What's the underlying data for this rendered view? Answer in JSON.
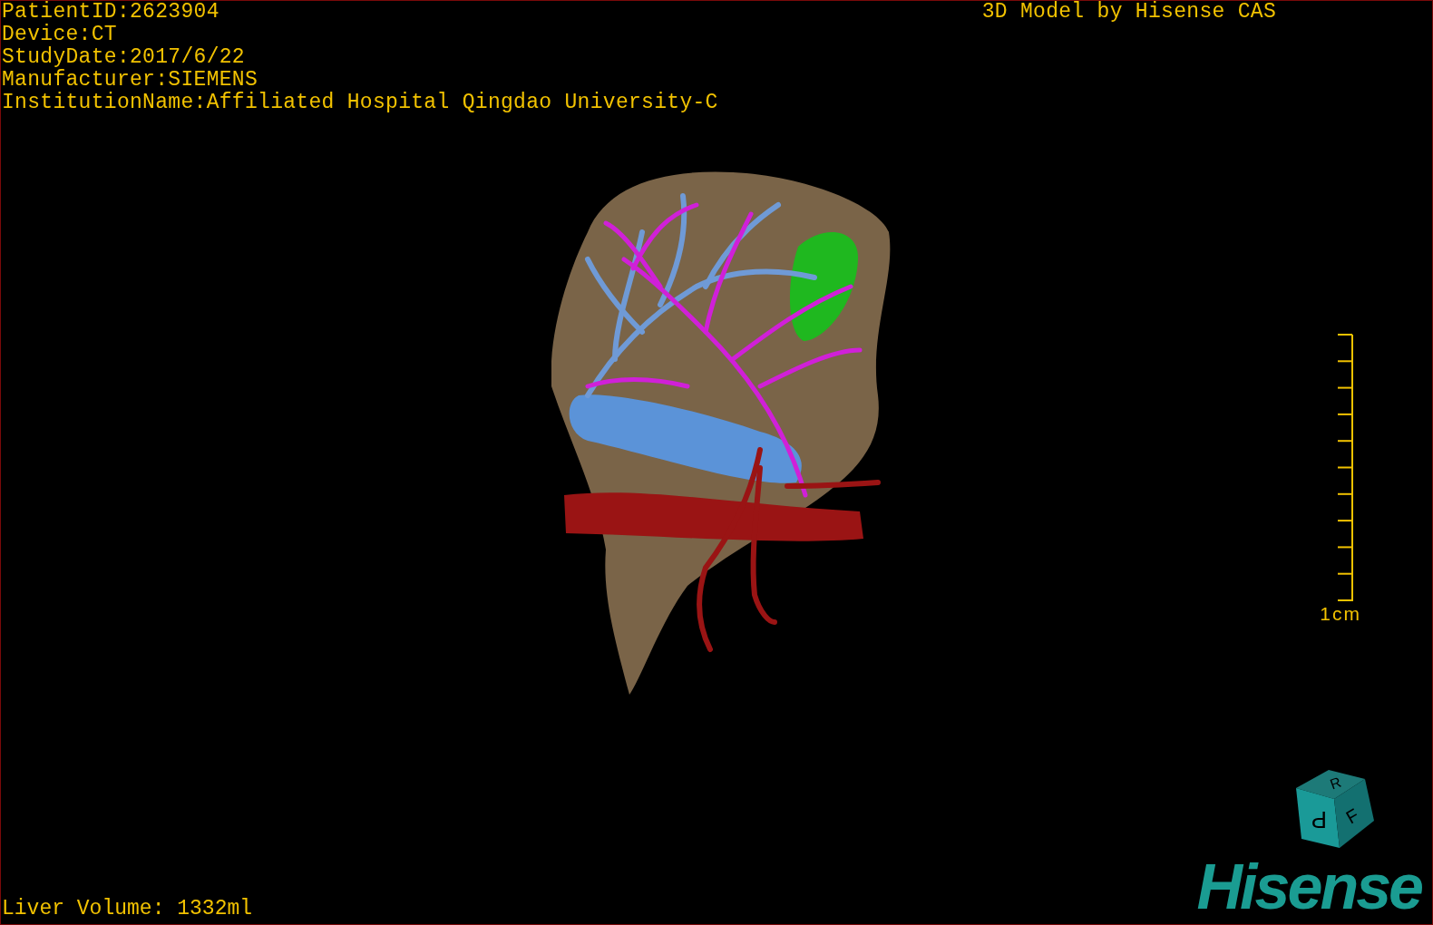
{
  "info_lines": [
    "PatientID:2623904",
    "Device:CT",
    "StudyDate:2017/6/22",
    "Manufacturer:SIEMENS",
    "InstitutionName:Affiliated Hospital Qingdao University-C"
  ],
  "credit": "3D Model by Hisense CAS",
  "scale_bar": {
    "label": "1cm"
  },
  "liver_volume": "Liver Volume: 1332ml",
  "orientation_cube": {
    "top": "R",
    "front": "P",
    "side": "F"
  },
  "logo": "Hisense"
}
